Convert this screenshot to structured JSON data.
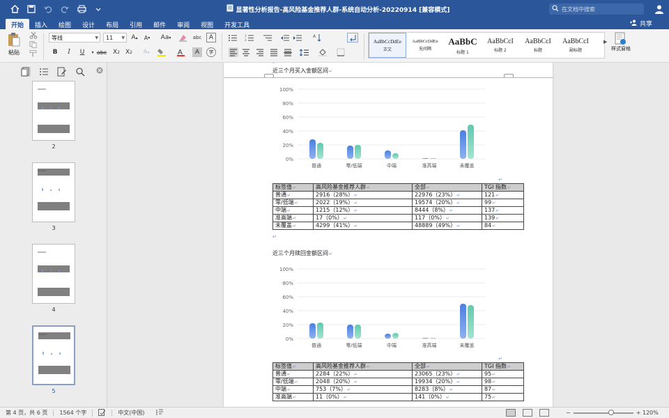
{
  "window": {
    "title": "显著性分析报告-高风险基金推荐人群-系统自动分析-20220914 [兼容模式]",
    "search_placeholder": "在文档中搜索"
  },
  "tabs": [
    "开始",
    "插入",
    "绘图",
    "设计",
    "布局",
    "引用",
    "邮件",
    "审阅",
    "视图",
    "开发工具"
  ],
  "active_tab": "开始",
  "share_label": "共享",
  "ribbon": {
    "paste_label": "粘贴",
    "font_name": "等线",
    "font_size": "11",
    "styles": [
      {
        "preview": "AaBbCcDdEe",
        "label": "正文",
        "selected": true
      },
      {
        "preview": "AaBbCcDdEe",
        "label": "无间隔",
        "selected": false
      },
      {
        "preview": "AaBbC",
        "label": "标题 1",
        "selected": false
      },
      {
        "preview": "AaBbCcI",
        "label": "标题 2",
        "selected": false
      },
      {
        "preview": "AaBbCcI",
        "label": "标题",
        "selected": false
      },
      {
        "preview": "AaBbCcI",
        "label": "副标题",
        "selected": false
      }
    ],
    "style_pane_label": "样式窗格"
  },
  "nav": {
    "pages": [
      "2",
      "3",
      "4",
      "5"
    ],
    "current_page": "5"
  },
  "document": {
    "para_mark": "↵",
    "section1": {
      "heading": "近三个月买入金额区间",
      "chart_data": {
        "type": "bar",
        "categories": [
          "普通",
          "零/低端",
          "中端",
          "准高端",
          "未覆盖"
        ],
        "series": [
          {
            "name": "高风险基金推荐人群",
            "values": [
              28,
              19,
              12,
              0,
              41
            ]
          },
          {
            "name": "全部",
            "values": [
              23,
              20,
              8,
              0,
              49
            ]
          }
        ],
        "yticks": [
          "100%",
          "80%",
          "60%",
          "40%",
          "20%",
          "0%"
        ],
        "ylim": [
          0,
          100
        ]
      },
      "table": {
        "headers": [
          "标签值",
          "高风险基金推荐人群",
          "全部",
          "TGI 指数"
        ],
        "rows": [
          [
            "普通",
            "2916（28%）",
            "22976（23%）",
            "121"
          ],
          [
            "零/低端",
            "2022（19%）",
            "19574（20%）",
            "99"
          ],
          [
            "中端",
            "1215（12%）",
            "8444（8%）",
            "137"
          ],
          [
            "准高端",
            "17（0%）",
            "117（0%）",
            "139"
          ],
          [
            "未覆盖",
            "4299（41%）",
            "48889（49%）",
            "84"
          ]
        ]
      }
    },
    "section2": {
      "heading": "近三个月赎回金额区间",
      "chart_data": {
        "type": "bar",
        "categories": [
          "普通",
          "零/低端",
          "中端",
          "准高端",
          "未覆盖"
        ],
        "series": [
          {
            "name": "高风险基金推荐人群",
            "values": [
              22,
              20,
              7,
              0,
              50
            ]
          },
          {
            "name": "全部",
            "values": [
              23,
              20,
              8,
              0,
              48
            ]
          }
        ],
        "yticks": [
          "100%",
          "80%",
          "60%",
          "40%",
          "20%",
          "0%"
        ],
        "ylim": [
          0,
          100
        ]
      },
      "table": {
        "headers": [
          "标签值",
          "高风险基金推荐人群",
          "全部",
          "TGI 指数"
        ],
        "rows": [
          [
            "普通",
            "2284（22%）",
            "23065（23%）",
            "95"
          ],
          [
            "零/低端",
            "2048（20%）",
            "19934（20%）",
            "98"
          ],
          [
            "中端",
            "753（7%）",
            "8283（8%）",
            "87"
          ],
          [
            "准高端",
            "11（0%）",
            "141（0%）",
            "75"
          ]
        ]
      }
    }
  },
  "status": {
    "page_info": "第 4 页，共 6 页",
    "word_count": "1564 个字",
    "language": "中文(中国)",
    "zoom": "120%"
  },
  "colors": {
    "title_bar": "#2b579a",
    "series1": "#4a7fe0",
    "series2": "#6fd0b8"
  }
}
